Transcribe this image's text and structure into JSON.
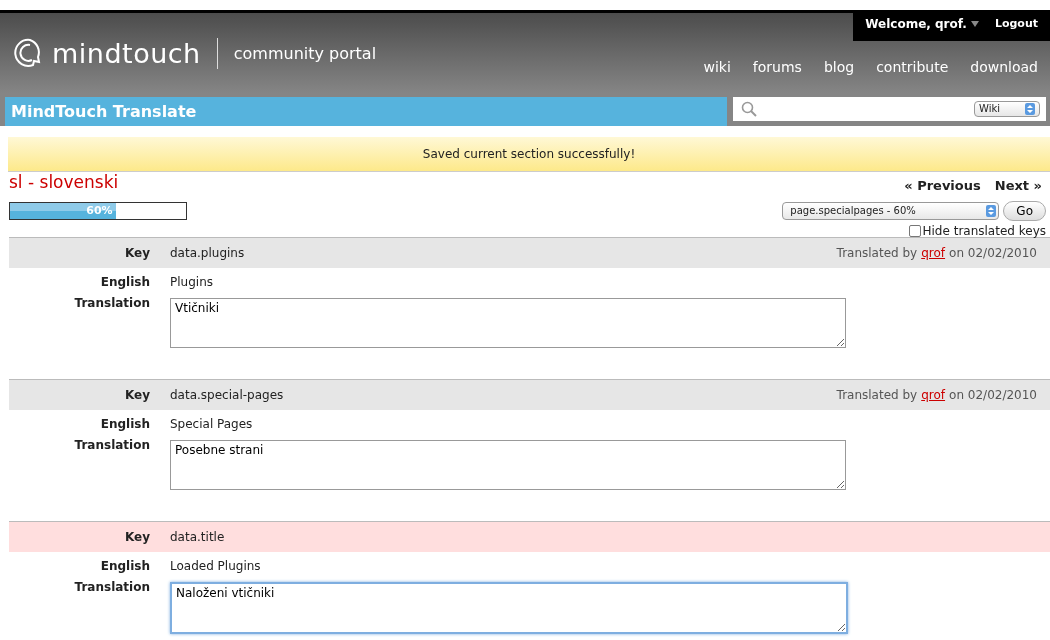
{
  "header": {
    "logo": "mindtouch",
    "portal": "community portal",
    "user_menu": "Welcome, qrof.",
    "logout": "Logout",
    "nav": [
      "wiki",
      "forums",
      "blog",
      "contribute",
      "download"
    ]
  },
  "titlebar": {
    "title": "MindTouch Translate"
  },
  "search": {
    "scope": "Wiki"
  },
  "message": "Saved current section successfully!",
  "language": "sl - slovenski",
  "progress": {
    "level": 0.6,
    "label": "60%"
  },
  "pager": {
    "previous": "« Previous",
    "next": "Next »"
  },
  "section_select": {
    "value": "page.specialpages - 60%",
    "go": "Go"
  },
  "hide_translated": {
    "label": "Hide translated keys",
    "checked": false
  },
  "entries": [
    {
      "key_label": "Key",
      "key": "data.plugins",
      "english_label": "English",
      "english": "Plugins",
      "translation_label": "Translation",
      "translation": "Vtičniki",
      "translated": true,
      "by_label": "Translated by",
      "translator": "qrof",
      "date": "on 02/02/2010",
      "focused": false
    },
    {
      "key_label": "Key",
      "key": "data.special-pages",
      "english_label": "English",
      "english": "Special Pages",
      "translation_label": "Translation",
      "translation": "Posebne strani",
      "translated": true,
      "by_label": "Translated by",
      "translator": "qrof",
      "date": "on 02/02/2010",
      "focused": false
    },
    {
      "key_label": "Key",
      "key": "data.title",
      "english_label": "English",
      "english": "Loaded Plugins",
      "translation_label": "Translation",
      "translation": "Naloženi vtičniki",
      "translated": false,
      "focused": true
    }
  ]
}
